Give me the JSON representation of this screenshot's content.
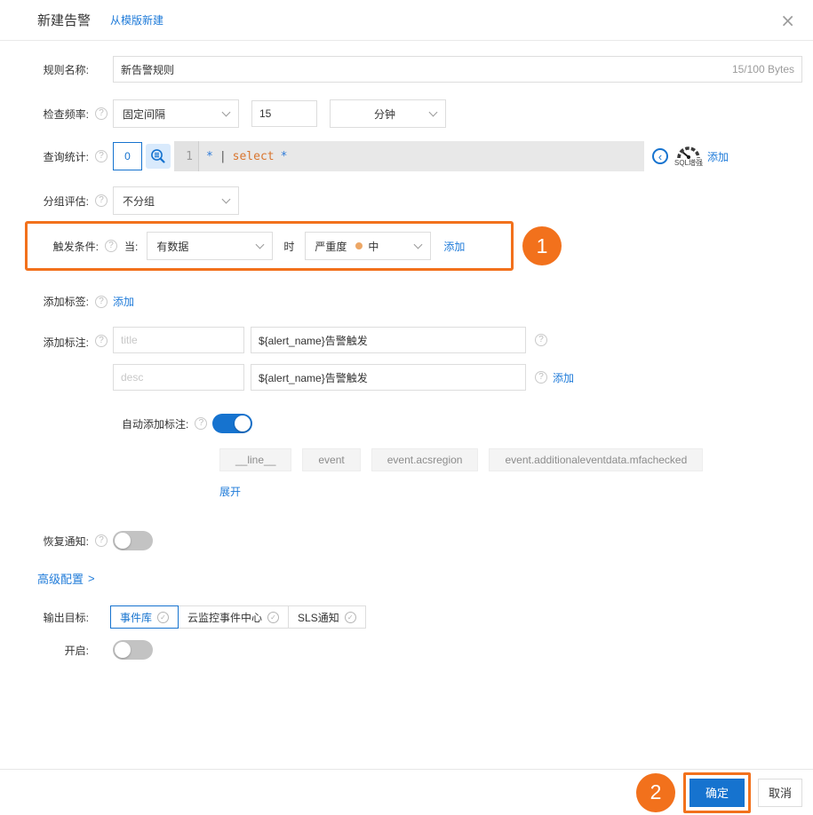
{
  "header": {
    "title": "新建告警",
    "template_link": "从模版新建"
  },
  "icons": {
    "help": "?",
    "close": "×",
    "collapse_left": "‹",
    "check": "✓",
    "chevron_right": "&gt;"
  },
  "form": {
    "rule_name": {
      "label": "规则名称:",
      "value": "新告警规则",
      "counter": "15/100 Bytes"
    },
    "check_frequency": {
      "label": "检查频率:",
      "interval_type": "固定间隔",
      "interval_value": "15",
      "unit": "分钟"
    },
    "query_stats": {
      "label": "查询统计:",
      "index_value": "0",
      "line_no": "1",
      "code_star1": "*",
      "code_pipe": "|",
      "code_keyword": "select",
      "code_star2": "*",
      "sql_enhance": "SQL增强",
      "add_link": "添加"
    },
    "group_eval": {
      "label": "分组评估:",
      "value": "不分组"
    },
    "trigger": {
      "label": "触发条件:",
      "when": "当:",
      "condition": "有数据",
      "then": "时",
      "severity_prefix": "严重度",
      "severity_value": "中",
      "add_link": "添加",
      "badge": "1"
    },
    "add_tags": {
      "label": "添加标签:",
      "add_link": "添加"
    },
    "annotations": {
      "label": "添加标注:",
      "rows": [
        {
          "placeholder": "title",
          "value": "${alert_name}告警触发"
        },
        {
          "placeholder": "desc",
          "value": "${alert_name}告警触发"
        }
      ],
      "add_link": "添加"
    },
    "auto_annotation": {
      "label": "自动添加标注:",
      "enabled": true,
      "chips": [
        "__line__",
        "event",
        "event.acsregion",
        "event.additionaleventdata.mfachecked"
      ],
      "expand_link": "展开"
    },
    "recovery_notify": {
      "label": "恢复通知:",
      "enabled": false
    },
    "advanced": {
      "link": "高级配置"
    },
    "output_target": {
      "label": "输出目标:",
      "tabs": [
        {
          "label": "事件库",
          "selected": true
        },
        {
          "label": "云监控事件中心",
          "selected": false
        },
        {
          "label": "SLS通知",
          "selected": false
        }
      ]
    },
    "enable": {
      "label": "开启:",
      "enabled": false
    }
  },
  "footer": {
    "confirm": "确定",
    "cancel": "取消",
    "badge": "2"
  },
  "colors": {
    "accent_blue": "#1673cf",
    "link_blue": "#1f7bd9",
    "highlight_orange": "#f2711c",
    "severity_dot": "#eda766",
    "code_keyword": "#d9752e",
    "code_symbol": "#2e7bd9",
    "editor_bg": "#e8e8e8"
  }
}
